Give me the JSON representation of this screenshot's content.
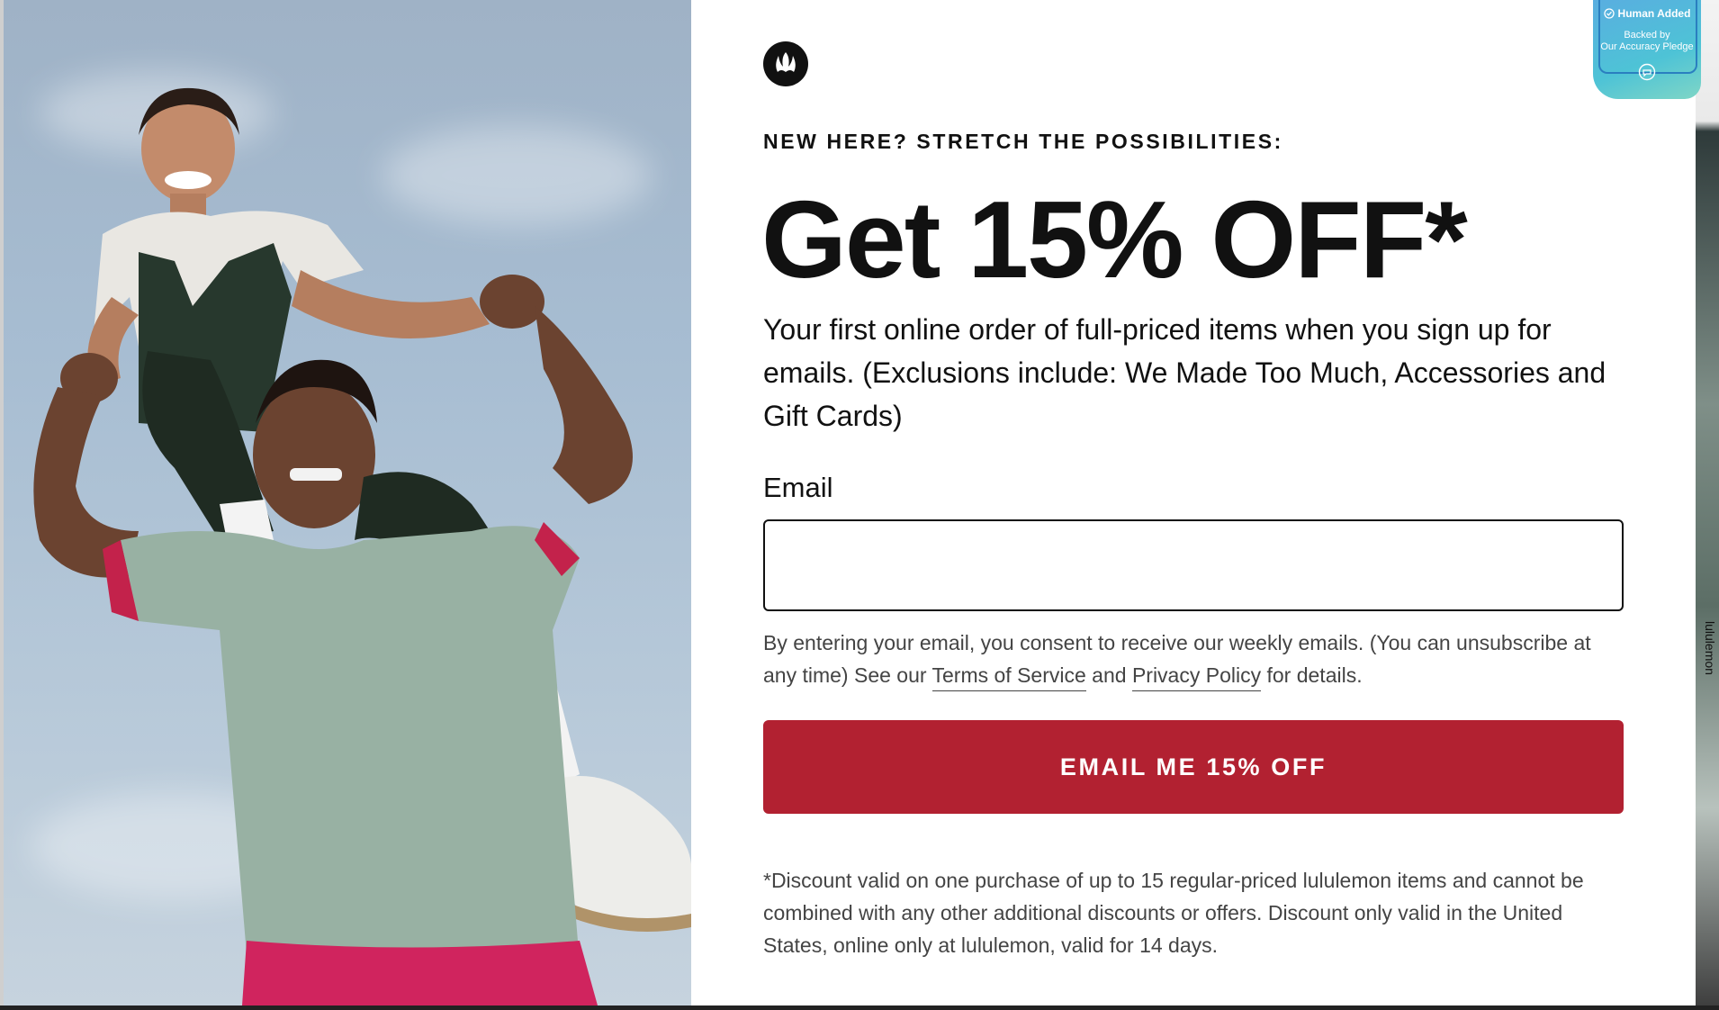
{
  "promo": {
    "eyebrow": "NEW HERE? STRETCH THE POSSIBILITIES:",
    "headline": "Get 15% OFF*",
    "description": "Your first online order of full-priced items when you sign up for emails. (Exclusions include: We Made Too Much, Accessories and Gift Cards)"
  },
  "form": {
    "email_label": "Email",
    "email_value": "",
    "consent_prefix": "By entering your email, you consent to receive our weekly emails. (You can unsubscribe at any time) See our",
    "terms_link": "Terms of Service",
    "consent_and": "and",
    "privacy_link": "Privacy Policy",
    "consent_suffix": "for details.",
    "submit_label": "EMAIL ME 15% OFF"
  },
  "fine_print": "*Discount valid on one purchase of up to 15 regular-priced lululemon items and cannot be combined with any other additional discounts or offers. Discount only valid in the United States, online only at lululemon, valid for 14 days.",
  "badge": {
    "title": "Human Added",
    "line1": "Backed by",
    "line2": "Our Accuracy Pledge"
  },
  "background": {
    "side_text": "lululemon"
  },
  "colors": {
    "cta": "#b22131",
    "text": "#111111",
    "muted": "#444444"
  },
  "icons": {
    "logo": "lululemon-logo-icon",
    "badge_check": "check-circle-icon",
    "badge_chat": "chat-bubble-icon"
  }
}
